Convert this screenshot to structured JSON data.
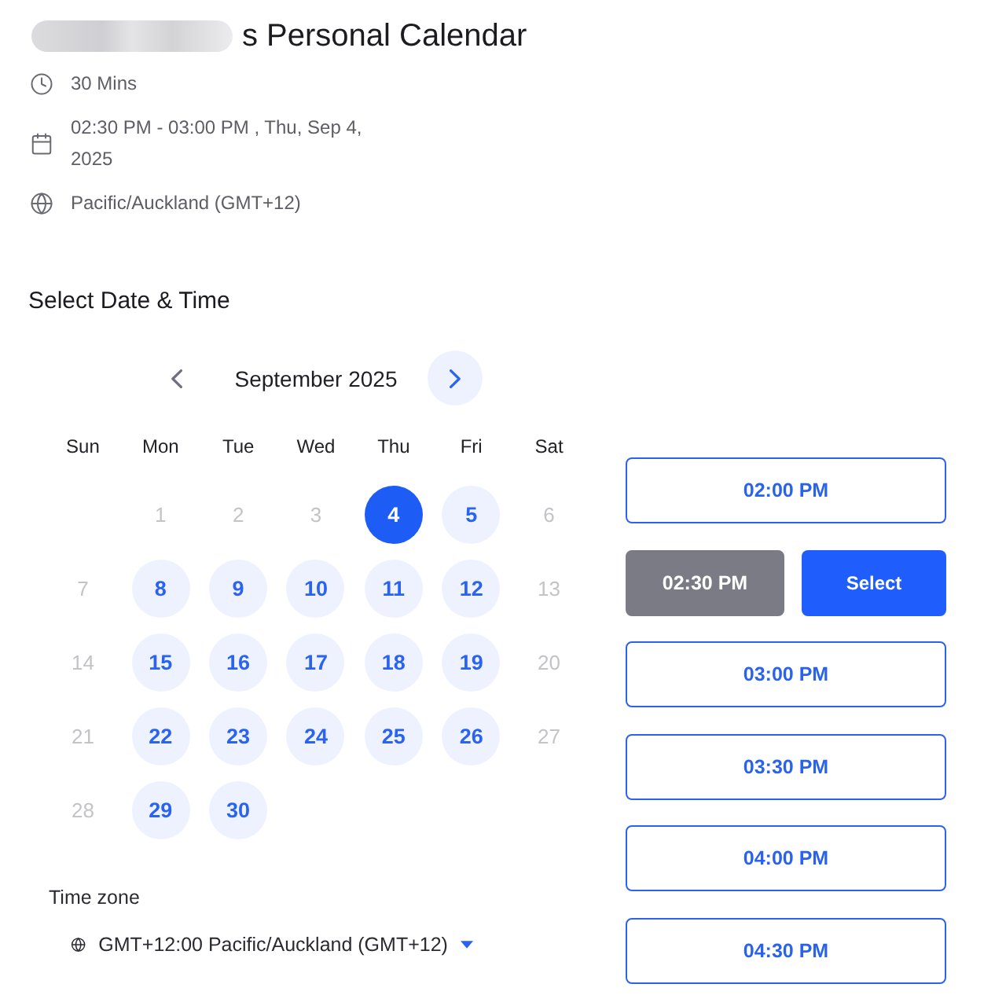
{
  "event": {
    "name_redacted": true,
    "title": "s Personal Calendar",
    "details": [
      {
        "kind": "duration",
        "text": "30 Mins"
      },
      {
        "kind": "datetime",
        "text": "02:30 PM - 03:00 PM , Thu, Sep 4, 2025"
      },
      {
        "kind": "timezone",
        "text": "Pacific/Auckland (GMT+12)"
      }
    ]
  },
  "section_title": "Select Date & Time",
  "calendar": {
    "month": "September 2025",
    "nav": [
      {
        "kind": "prev",
        "disabled": true
      },
      {
        "kind": "next",
        "disabled": false
      }
    ],
    "weekdays": [
      "Sun",
      "Mon",
      "Tue",
      "Wed",
      "Thu",
      "Fri",
      "Sat"
    ],
    "weeks": [
      [
        {
          "kind": "blank"
        },
        {
          "kind": "day",
          "label": "1",
          "available": false,
          "selected": false
        },
        {
          "kind": "day",
          "label": "2",
          "available": false,
          "selected": false
        },
        {
          "kind": "day",
          "label": "3",
          "available": false,
          "selected": false
        },
        {
          "kind": "day",
          "label": "4",
          "available": true,
          "selected": true
        },
        {
          "kind": "day",
          "label": "5",
          "available": true,
          "selected": false
        },
        {
          "kind": "day",
          "label": "6",
          "available": false,
          "selected": false
        }
      ],
      [
        {
          "kind": "day",
          "label": "7",
          "available": false,
          "selected": false
        },
        {
          "kind": "day",
          "label": "8",
          "available": true,
          "selected": false
        },
        {
          "kind": "day",
          "label": "9",
          "available": true,
          "selected": false
        },
        {
          "kind": "day",
          "label": "10",
          "available": true,
          "selected": false
        },
        {
          "kind": "day",
          "label": "11",
          "available": true,
          "selected": false
        },
        {
          "kind": "day",
          "label": "12",
          "available": true,
          "selected": false
        },
        {
          "kind": "day",
          "label": "13",
          "available": false,
          "selected": false
        }
      ],
      [
        {
          "kind": "day",
          "label": "14",
          "available": false,
          "selected": false
        },
        {
          "kind": "day",
          "label": "15",
          "available": true,
          "selected": false
        },
        {
          "kind": "day",
          "label": "16",
          "available": true,
          "selected": false
        },
        {
          "kind": "day",
          "label": "17",
          "available": true,
          "selected": false
        },
        {
          "kind": "day",
          "label": "18",
          "available": true,
          "selected": false
        },
        {
          "kind": "day",
          "label": "19",
          "available": true,
          "selected": false
        },
        {
          "kind": "day",
          "label": "20",
          "available": false,
          "selected": false
        }
      ],
      [
        {
          "kind": "day",
          "label": "21",
          "available": false,
          "selected": false
        },
        {
          "kind": "day",
          "label": "22",
          "available": true,
          "selected": false
        },
        {
          "kind": "day",
          "label": "23",
          "available": true,
          "selected": false
        },
        {
          "kind": "day",
          "label": "24",
          "available": true,
          "selected": false
        },
        {
          "kind": "day",
          "label": "25",
          "available": true,
          "selected": false
        },
        {
          "kind": "day",
          "label": "26",
          "available": true,
          "selected": false
        },
        {
          "kind": "day",
          "label": "27",
          "available": false,
          "selected": false
        }
      ],
      [
        {
          "kind": "day",
          "label": "28",
          "available": false,
          "selected": false
        },
        {
          "kind": "day",
          "label": "29",
          "available": true,
          "selected": false
        },
        {
          "kind": "day",
          "label": "30",
          "available": true,
          "selected": false
        }
      ]
    ]
  },
  "time_zone": {
    "label": "Time zone",
    "value": "GMT+12:00 Pacific/Auckland (GMT+12)"
  },
  "time_slots": {
    "confirm_label": "Select",
    "items": [
      {
        "label": "02:00 PM",
        "selected": false
      },
      {
        "label": "02:30 PM",
        "selected": true
      },
      {
        "label": "03:00 PM",
        "selected": false
      },
      {
        "label": "03:30 PM",
        "selected": false
      },
      {
        "label": "04:00 PM",
        "selected": false
      },
      {
        "label": "04:30 PM",
        "selected": false
      }
    ]
  }
}
